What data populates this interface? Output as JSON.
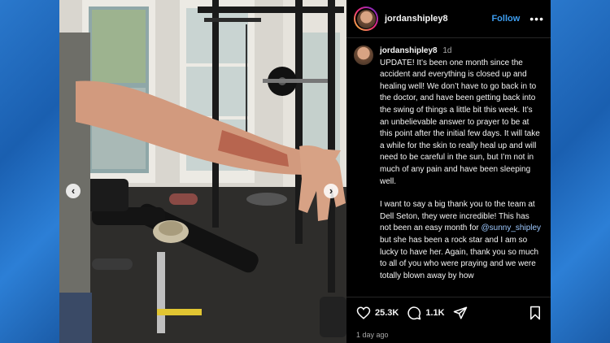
{
  "post": {
    "username": "jordanshipley8",
    "follow_label": "Follow",
    "more_label": "•••",
    "caption": {
      "username": "jordanshipley8",
      "time": "1d",
      "paragraph1": "UPDATE!  It’s been one month since the accident and everything is closed up and healing well!  We don’t have to go back in to the doctor, and have been getting back into the swing of things a little bit this week.  It’s an unbelievable answer to prayer to be at this point after the initial few days.  It will take a while for the skin to really heal up and will need to be careful in the sun, but I’m not in much of any pain and have been sleeping well.",
      "paragraph2_before": "I want to say a big thank you to the team at Dell Seton, they were incredible!  This has not been an easy month for ",
      "mention": "@sunny_shipley",
      "paragraph2_after": " but she has been a rock star and I am so lucky to have her.  Again, thank you so much to all of you who were praying and we were totally blown away by how"
    },
    "likes": "25.3K",
    "comments": "1.1K",
    "posted_ago": "1 day ago",
    "nav_prev": "‹",
    "nav_next": "›"
  },
  "icons": [
    "heart-icon",
    "comment-icon",
    "share-icon",
    "bookmark-icon",
    "more-icon"
  ],
  "colors": {
    "follow": "#3d9df0",
    "background_blue": "#1d64b8",
    "panel": "#000000"
  }
}
